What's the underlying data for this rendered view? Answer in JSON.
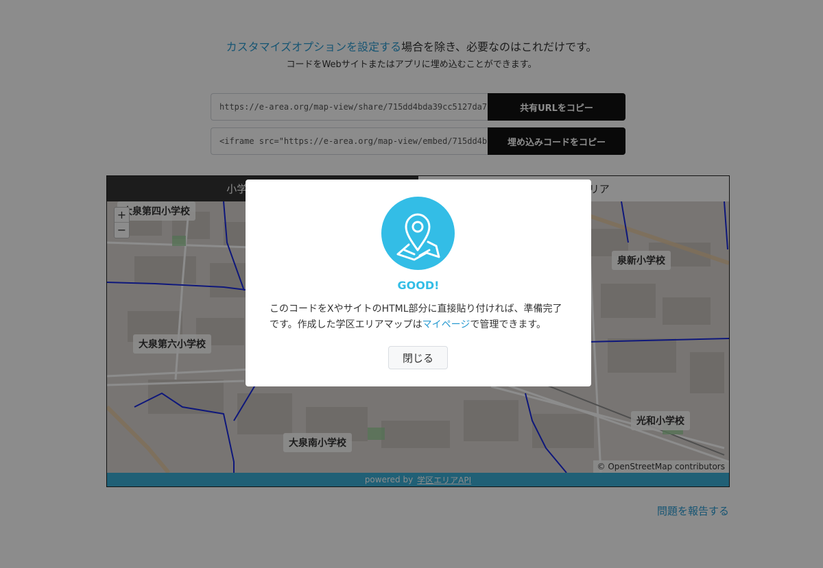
{
  "intro": {
    "link_text": "カスタマイズオプションを設定する",
    "rest_text": "場合を除き、必要なのはこれだけです。",
    "line2": "コードをWebサイトまたはアプリに埋め込むことができます。"
  },
  "share": {
    "url_value": "https://e-area.org/map-view/share/715dd4bda39cc5127da7",
    "copy_url_label": "共有URLをコピー",
    "embed_value": "<iframe src=\"https://e-area.org/map-view/embed/715dd4b",
    "copy_embed_label": "埋め込みコードをコピー"
  },
  "map": {
    "tabs": [
      {
        "label": "小学校区エリア"
      },
      {
        "label": "中学校区エリア"
      }
    ],
    "zoom_in": "+",
    "zoom_out": "−",
    "schools": [
      {
        "label": "大泉第六小学校"
      },
      {
        "label": "大泉南小学校"
      },
      {
        "label": "泉新小学校"
      },
      {
        "label": "光和小学校"
      },
      {
        "label": "大泉第四小学校"
      }
    ],
    "attribution": "© OpenStreetMap contributors",
    "powered_by": "powered by",
    "api_link": "学区エリアAPI"
  },
  "report_link": "問題を報告する",
  "modal": {
    "icon": "map-pin-icon",
    "title": "GOOD!",
    "message_part1": "このコードをXやサイトのHTML部分に直接貼り付ければ、準備完了です。作成した学区エリアマップは",
    "message_link": "マイページ",
    "message_part2": "で管理できます。",
    "close_label": "閉じる"
  },
  "colors": {
    "accent": "#2a9bd1",
    "icon_bg": "#33bde6",
    "boundary": "#1a2be0",
    "button_dark": "#111111"
  }
}
